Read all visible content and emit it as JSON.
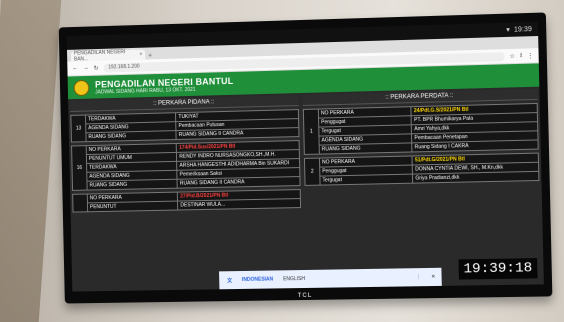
{
  "status": {
    "time": "19:39"
  },
  "browser": {
    "tab_label": "PENGADILAN NEGERI BAN...",
    "url": "192.168.1.200"
  },
  "header": {
    "title": "PENGADILAN NEGERI BANTUL",
    "subtitle": "JADWAL SIDANG HARI RABU, 13 OKT. 2021"
  },
  "pidana": {
    "title": ":: PERKARA PIDANA ::",
    "blocks": [
      {
        "num": "13",
        "rows": [
          {
            "label": "TERDAKWA",
            "value": "TUKIYAT"
          },
          {
            "label": "AGENDA SIDANG",
            "value": "Pembacaan Putusan"
          },
          {
            "label": "RUANG SIDANG",
            "value": "RUANG SIDANG II CANDRA"
          }
        ]
      },
      {
        "num": "16",
        "rows": [
          {
            "label": "NO PERKARA",
            "value": "174/Pid.Sus/2021/PN Btl"
          },
          {
            "label": "PENUNTUT UMUM",
            "value": "RENDY INDRO NURSASONGKO,SH.,M.H."
          },
          {
            "label": "TERDAKWA",
            "value": "ARSHA HANGESTHI ADIDHARMA Bin SUKARDI"
          },
          {
            "label": "AGENDA SIDANG",
            "value": "Pemeriksaan Saksi"
          },
          {
            "label": "RUANG SIDANG",
            "value": "RUANG SIDANG II CANDRA"
          }
        ]
      },
      {
        "num": "",
        "rows": [
          {
            "label": "NO PERKARA",
            "value": "27/Pid.B/2021/PN Btl"
          },
          {
            "label": "PENUNTUT",
            "value": "DESTINAR WULA..."
          }
        ]
      }
    ]
  },
  "perdata": {
    "title": ":: PERKARA PERDATA ::",
    "blocks": [
      {
        "num": "1",
        "rows": [
          {
            "label": "NO PERKARA",
            "value": "24/Pdt.G.S/2021/PN Btl"
          },
          {
            "label": "Penggugat",
            "value": "PT. BPR Bhumikarya Pala"
          },
          {
            "label": "Tergugat",
            "value": "Amri Yahya,dkk"
          },
          {
            "label": "AGENDA SIDANG",
            "value": "Pembacaan Penetapan"
          },
          {
            "label": "RUANG SIDANG",
            "value": "Ruang Sidang I CAKRA"
          }
        ]
      },
      {
        "num": "2",
        "rows": [
          {
            "label": "NO PERKARA",
            "value": "51/Pdt.G/2021/PN Btl"
          },
          {
            "label": "Penggugat",
            "value": "DONNA CYNTIA DEWI, SH., M.Kn,dkk"
          },
          {
            "label": "Tergugat",
            "value": "Griya Pradianzi,dkk"
          }
        ]
      }
    ]
  },
  "translate_bar": {
    "lang1": "INDONESIAN",
    "lang2": "ENGLISH"
  },
  "clock": "19:39:18",
  "brand": "TCL",
  "colors": {
    "header_green": "#1f8f3a",
    "case_yellow": "#ffd800",
    "case_red": "#ff4040"
  }
}
